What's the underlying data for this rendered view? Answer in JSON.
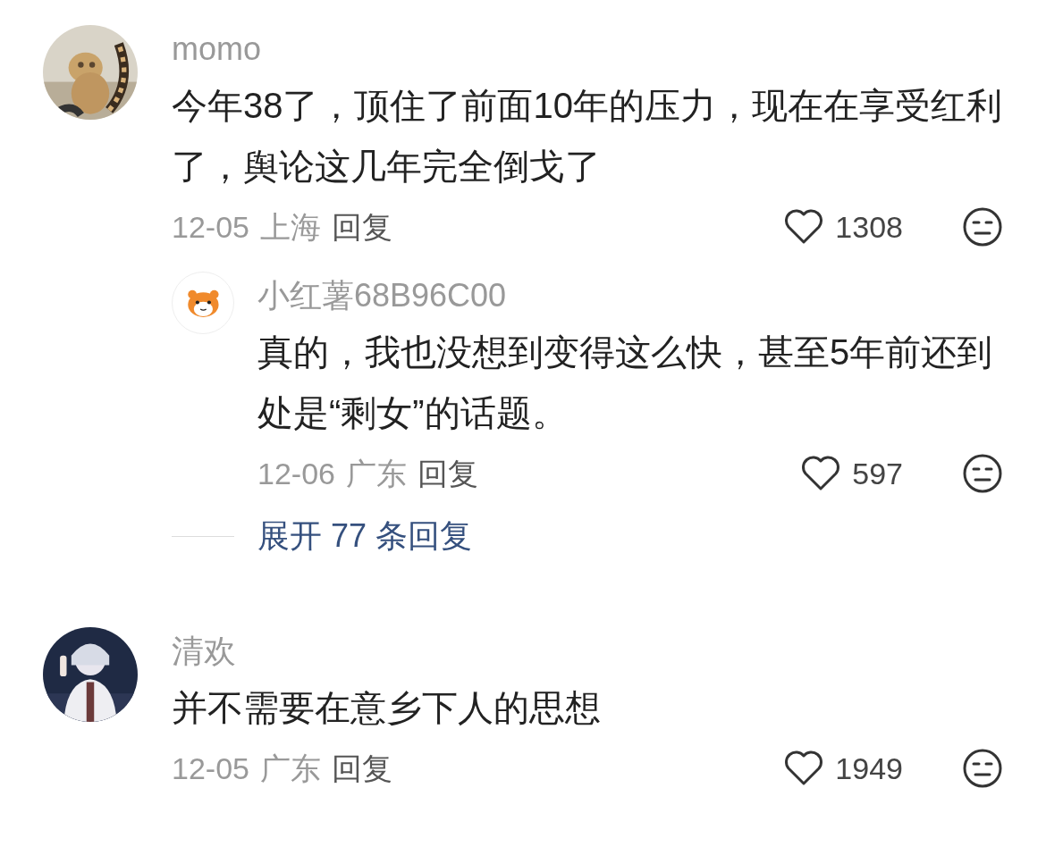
{
  "comments": [
    {
      "avatar": {
        "kind": "picture"
      },
      "name": "momo",
      "text": "今年38了，顶住了前面10年的压力，现在在享受红利了，舆论这几年完全倒戈了",
      "date": "12-05",
      "location": "上海",
      "reply_label": "回复",
      "likes": "1308",
      "replies": [
        {
          "avatar": {
            "kind": "icon"
          },
          "name": "小红薯68B96C00",
          "text": "真的，我也没想到变得这么快，甚至5年前还到处是“剩女”的话题。",
          "date": "12-06",
          "location": "广东",
          "reply_label": "回复",
          "likes": "597"
        }
      ],
      "expand": "展开 77 条回复"
    },
    {
      "avatar": {
        "kind": "picture"
      },
      "name": "清欢",
      "text": "并不需要在意乡下人的思想",
      "date": "12-05",
      "location": "广东",
      "reply_label": "回复",
      "likes": "1949"
    }
  ]
}
